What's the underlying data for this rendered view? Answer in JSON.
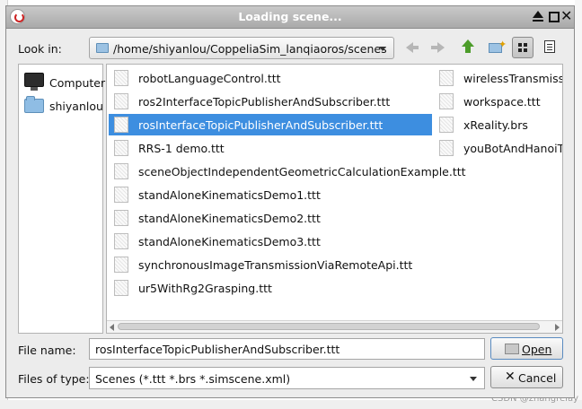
{
  "window": {
    "title": "Loading scene..."
  },
  "look_in": {
    "label": "Look in:",
    "path": "/home/shiyanlou/CoppeliaSim_lanqiaoros/scenes"
  },
  "toolbar": {
    "icons": [
      "back-arrow-icon",
      "forward-arrow-icon",
      "parent-folder-icon",
      "new-folder-icon",
      "list-view-icon",
      "detail-view-icon"
    ]
  },
  "sidebar": {
    "items": [
      {
        "label": "Computer",
        "icon": "computer-icon"
      },
      {
        "label": "shiyanlou",
        "icon": "folder-icon"
      }
    ]
  },
  "files": {
    "column1": [
      "robotLanguageControl.ttt",
      "ros2InterfaceTopicPublisherAndSubscriber.ttt",
      "rosInterfaceTopicPublisherAndSubscriber.ttt",
      "RRS-1 demo.ttt",
      "sceneObjectIndependentGeometricCalculationExample.ttt",
      "standAloneKinematicsDemo1.ttt",
      "standAloneKinematicsDemo2.ttt",
      "standAloneKinematicsDemo3.ttt",
      "synchronousImageTransmissionViaRemoteApi.ttt",
      "ur5WithRg2Grasping.ttt"
    ],
    "column2": [
      "wirelessTransmissio",
      "workspace.ttt",
      "xReality.brs",
      "youBotAndHanoiTow"
    ],
    "selected": "rosInterfaceTopicPublisherAndSubscriber.ttt"
  },
  "file_name": {
    "label": "File name:",
    "value": "rosInterfaceTopicPublisherAndSubscriber.ttt"
  },
  "file_type": {
    "label": "Files of type:",
    "value": "Scenes (*.ttt *.brs *.simscene.xml)"
  },
  "buttons": {
    "open": "Open",
    "cancel": "Cancel"
  },
  "watermark": "CSDN @zhangrelay",
  "colors": {
    "selection": "#3d8ee0",
    "titlebar": "#b5b5b5",
    "dialog_bg": "#ececec"
  }
}
